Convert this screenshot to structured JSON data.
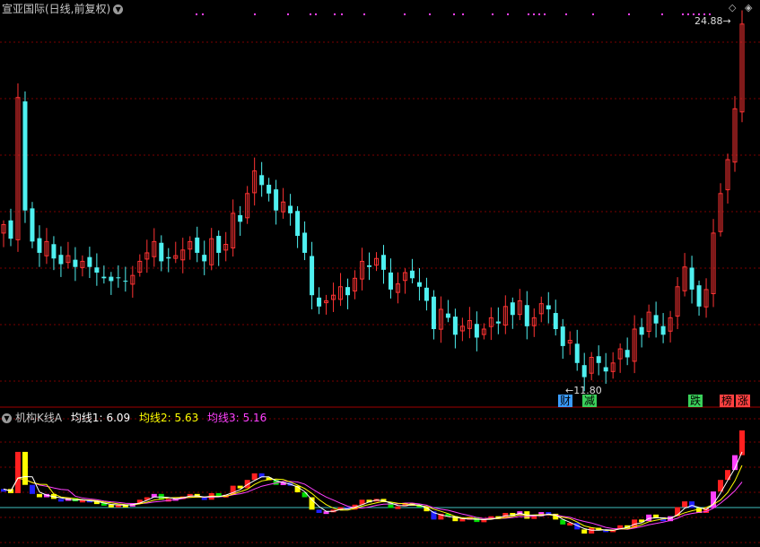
{
  "header": {
    "title": "宣亚国际(日线,前复权)",
    "chevron_icon": "chevron-down-icon"
  },
  "price_labels": {
    "max": "24.88",
    "min": "11.80"
  },
  "event_tags": [
    {
      "text": "财",
      "color": "#3a9cff"
    },
    {
      "text": "减",
      "color": "#3ad05a"
    },
    {
      "text": "跌",
      "color": "#3ad05a"
    },
    {
      "text": "榜",
      "color": "#ff4040"
    },
    {
      "text": "涨",
      "color": "#ff4040"
    }
  ],
  "indicator": {
    "name": "机构K线A",
    "ma1_label": "均线1:",
    "ma1_value": "6.09",
    "ma2_label": "均线2:",
    "ma2_value": "5.63",
    "ma3_label": "均线3:",
    "ma3_value": "5.16",
    "colors": {
      "name": "#c8c8c8",
      "ma1": "#ffffff",
      "ma2": "#ffff00",
      "ma3": "#ff40ff"
    }
  },
  "colors": {
    "up": "#ff3333",
    "down": "#4ff0f0",
    "grid": "#7a0000",
    "baseline": "#40c0c0",
    "bar_palette": [
      "#ff40ff",
      "#ffff00",
      "#00dd00",
      "#2020ff",
      "#ff2020"
    ]
  },
  "chart_data": {
    "type": "candlestick",
    "y_min": 11.8,
    "y_max": 24.88,
    "closes": [
      17.5,
      17.0,
      22.0,
      18.0,
      16.9,
      16.5,
      16.9,
      16.3,
      16.1,
      16.4,
      16.0,
      16.2,
      16.0,
      15.8,
      15.6,
      15.5,
      15.6,
      15.5,
      15.7,
      16.2,
      16.5,
      16.9,
      16.2,
      16.3,
      16.4,
      16.6,
      16.9,
      16.5,
      16.2,
      17.0,
      16.5,
      16.8,
      17.9,
      17.6,
      18.6,
      19.4,
      18.9,
      18.6,
      18.0,
      18.3,
      17.9,
      17.1,
      16.5,
      15.0,
      14.6,
      14.8,
      15.0,
      15.3,
      15.0,
      15.6,
      16.2,
      16.0,
      16.3,
      15.9,
      15.2,
      15.4,
      15.8,
      15.6,
      15.3,
      14.8,
      13.8,
      14.5,
      14.2,
      13.6,
      13.9,
      14.1,
      13.5,
      13.8,
      14.2,
      14.0,
      14.6,
      14.3,
      14.8,
      13.9,
      14.2,
      14.7,
      14.5,
      13.8,
      13.2,
      13.4,
      12.6,
      12.1,
      12.8,
      12.6,
      12.3,
      12.6,
      13.1,
      12.8,
      13.8,
      13.6,
      14.4,
      14.0,
      13.6,
      14.2,
      15.3,
      16.0,
      15.2,
      14.6,
      15.2,
      17.2,
      18.6,
      19.8,
      21.6,
      24.6
    ],
    "ma1": [
      6.09
    ],
    "ma2": [
      5.63
    ],
    "ma3": [
      5.16
    ]
  }
}
